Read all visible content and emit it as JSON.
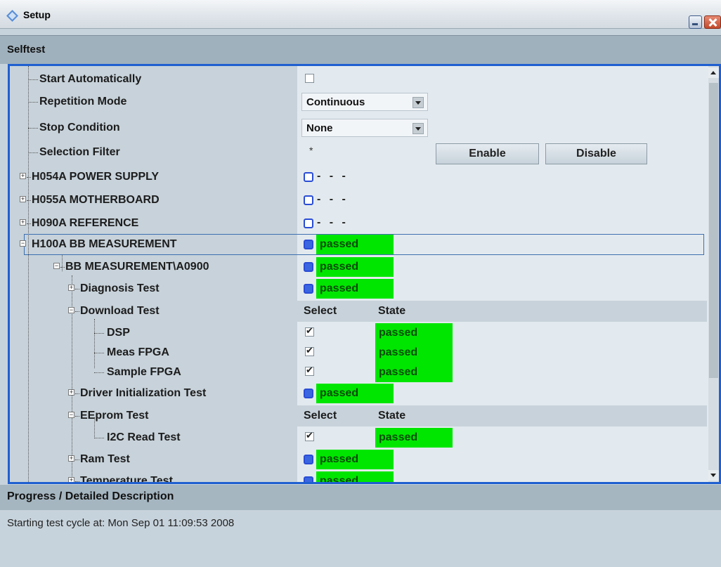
{
  "window": {
    "title": "Setup",
    "app_icon": "rohde-schwarz-diamond-icon",
    "minimize_icon": "minimize-icon",
    "close_icon": "close-icon"
  },
  "section": {
    "title": "Selftest"
  },
  "settings": {
    "start_automatically": {
      "label": "Start Automatically",
      "checked": false
    },
    "repetition_mode": {
      "label": "Repetition Mode",
      "value": "Continuous"
    },
    "stop_condition": {
      "label": "Stop Condition",
      "value": "None"
    },
    "selection_filter": {
      "label": "Selection Filter",
      "value": "*",
      "enable_label": "Enable",
      "disable_label": "Disable"
    }
  },
  "modules": [
    {
      "label": "H054A POWER SUPPLY",
      "state": "- - -"
    },
    {
      "label": "H055A MOTHERBOARD",
      "state": "- - -"
    },
    {
      "label": "H090A REFERENCE",
      "state": "- - -"
    },
    {
      "label": "H100A BB MEASUREMENT",
      "state": "passed"
    }
  ],
  "subtree": {
    "bb_measurement": {
      "label": "BB MEASUREMENT\\A0900",
      "state": "passed"
    },
    "diagnosis": {
      "label": "Diagnosis Test",
      "state": "passed"
    },
    "download": {
      "label": "Download Test"
    },
    "columns": {
      "select": "Select",
      "state": "State"
    },
    "download_items": [
      {
        "label": "DSP",
        "checked": true,
        "state": "passed"
      },
      {
        "label": "Meas FPGA",
        "checked": true,
        "state": "passed"
      },
      {
        "label": "Sample FPGA",
        "checked": true,
        "state": "passed"
      }
    ],
    "driver_init": {
      "label": "Driver Initialization Test",
      "state": "passed"
    },
    "eeprom": {
      "label": "EEprom Test"
    },
    "eeprom_items": [
      {
        "label": "I2C Read Test",
        "checked": true,
        "state": "passed"
      }
    ],
    "ram": {
      "label": "Ram Test",
      "state": "passed"
    },
    "temperature": {
      "label": "Temperature Test",
      "state": "passed"
    }
  },
  "progress": {
    "title": "Progress / Detailed Description",
    "text": "Starting test cycle at: Mon Sep 01 11:09:53 2008"
  },
  "colors": {
    "selection_border": "#1f5fd0",
    "passed": "#00e600",
    "status_blue": "#3a66e0"
  }
}
